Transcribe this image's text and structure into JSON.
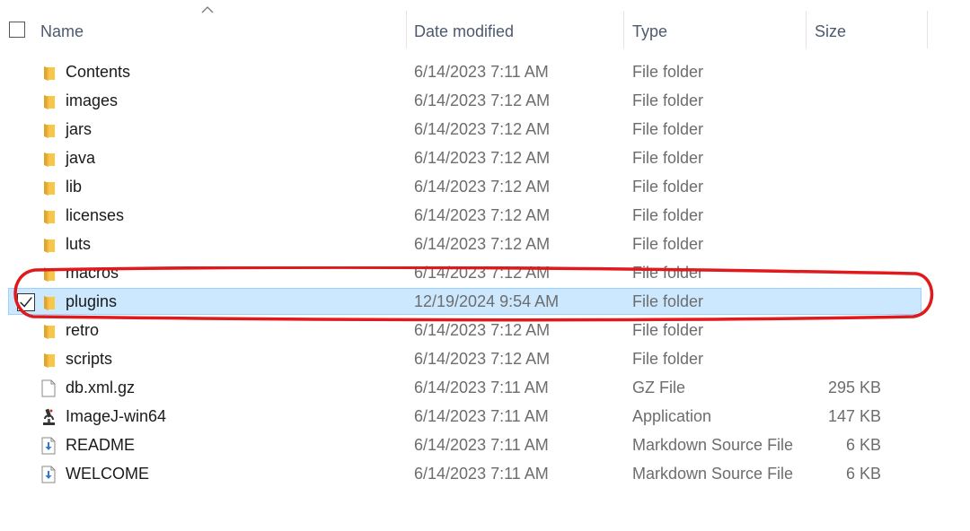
{
  "header": {
    "name_label": "Name",
    "date_label": "Date modified",
    "type_label": "Type",
    "size_label": "Size"
  },
  "files": [
    {
      "name": "Contents",
      "date": "6/14/2023 7:11 AM",
      "type": "File folder",
      "size": "",
      "icon": "folder-icon"
    },
    {
      "name": "images",
      "date": "6/14/2023 7:12 AM",
      "type": "File folder",
      "size": "",
      "icon": "folder-icon"
    },
    {
      "name": "jars",
      "date": "6/14/2023 7:12 AM",
      "type": "File folder",
      "size": "",
      "icon": "folder-icon"
    },
    {
      "name": "java",
      "date": "6/14/2023 7:12 AM",
      "type": "File folder",
      "size": "",
      "icon": "folder-icon"
    },
    {
      "name": "lib",
      "date": "6/14/2023 7:12 AM",
      "type": "File folder",
      "size": "",
      "icon": "folder-icon"
    },
    {
      "name": "licenses",
      "date": "6/14/2023 7:12 AM",
      "type": "File folder",
      "size": "",
      "icon": "folder-icon"
    },
    {
      "name": "luts",
      "date": "6/14/2023 7:12 AM",
      "type": "File folder",
      "size": "",
      "icon": "folder-icon"
    },
    {
      "name": "macros",
      "date": "6/14/2023 7:12 AM",
      "type": "File folder",
      "size": "",
      "icon": "folder-icon"
    },
    {
      "name": "plugins",
      "date": "12/19/2024 9:54 AM",
      "type": "File folder",
      "size": "",
      "icon": "folder-icon",
      "selected": true
    },
    {
      "name": "retro",
      "date": "6/14/2023 7:12 AM",
      "type": "File folder",
      "size": "",
      "icon": "folder-icon"
    },
    {
      "name": "scripts",
      "date": "6/14/2023 7:12 AM",
      "type": "File folder",
      "size": "",
      "icon": "folder-icon"
    },
    {
      "name": "db.xml.gz",
      "date": "6/14/2023 7:11 AM",
      "type": "GZ File",
      "size": "295 KB",
      "icon": "file-icon"
    },
    {
      "name": "ImageJ-win64",
      "date": "6/14/2023 7:11 AM",
      "type": "Application",
      "size": "147 KB",
      "icon": "microscope-app-icon"
    },
    {
      "name": "README",
      "date": "6/14/2023 7:11 AM",
      "type": "Markdown Source File",
      "size": "6 KB",
      "icon": "markdown-file-icon"
    },
    {
      "name": "WELCOME",
      "date": "6/14/2023 7:11 AM",
      "type": "Markdown Source File",
      "size": "6 KB",
      "icon": "markdown-file-icon"
    }
  ],
  "colors": {
    "selection_bg": "#cce8ff",
    "selection_border": "#99d1ff",
    "folder": "#f8c74a",
    "annotation": "#e0191c"
  }
}
